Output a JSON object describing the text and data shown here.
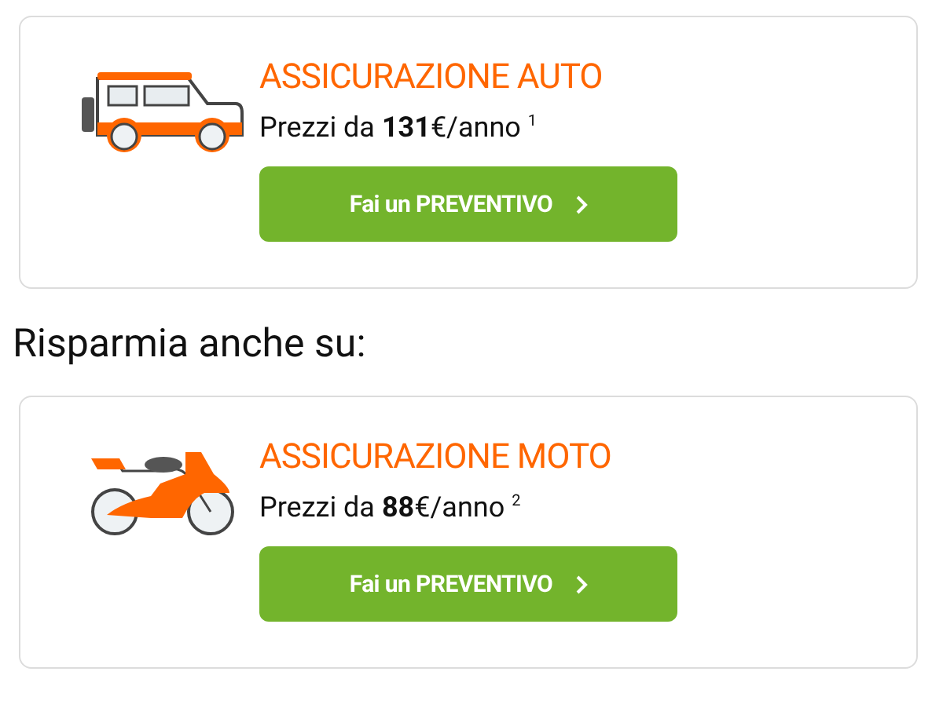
{
  "offers": [
    {
      "kind": "car",
      "title": "ASSICURAZIONE AUTO",
      "price": "Prezzi da **131**€/anno $^{1}$",
      "button": "Fai un PREVENTIVO"
    }
  ],
  "section_heading": "Risparmia anche su:",
  "more_offers": [
    {
      "kind": "motorcycle",
      "title": "ASSICURAZIONE MOTO",
      "price": "Prezzi da **88**€/anno $^{2}$",
      "button": "Fai un PREVENTIVO"
    }
  ]
}
